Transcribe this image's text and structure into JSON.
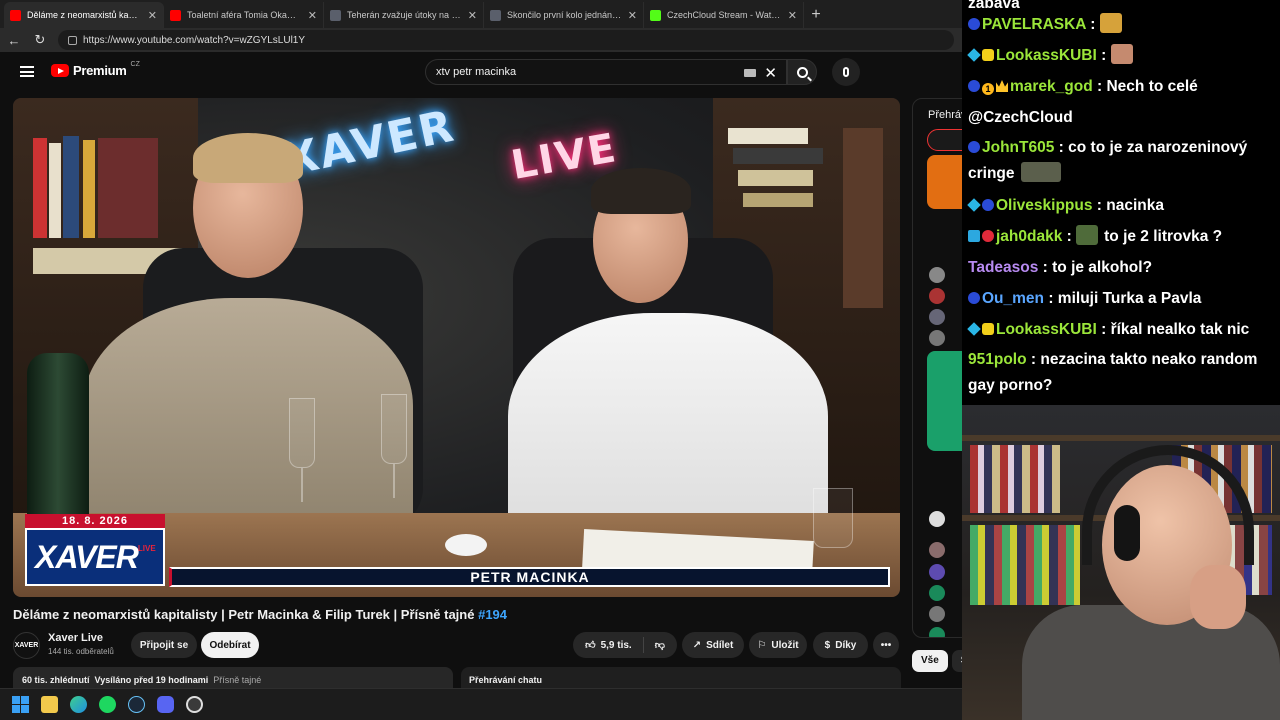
{
  "browser": {
    "tabs": [
      {
        "label": "Děláme z neomarxistů kapitalistu",
        "favicon_color": "#ff0000",
        "active": true
      },
      {
        "label": "Toaletní aféra Tomia Okamury. Co",
        "favicon_color": "#ff0000",
        "active": false
      },
      {
        "label": "Teherán zvažuje útoky na vojensk",
        "favicon_color": "#5a5f6b",
        "active": false
      },
      {
        "label": "Skončilo první kolo jednání minist",
        "favicon_color": "#5a5f6b",
        "active": false
      },
      {
        "label": "CzechCloud Stream - Watch Live o",
        "favicon_color": "#53fc18",
        "active": false
      }
    ],
    "url": "https://www.youtube.com/watch?v=wZGYLsLUl1Y"
  },
  "youtube": {
    "brand": "Premium",
    "country": "CZ",
    "search_value": "xtv petr macinka",
    "video": {
      "neon_left": "XAVER",
      "neon_right": "LIVE",
      "date": "18. 8. 2026",
      "logo_text": "XAVER",
      "logo_live": "LIVE",
      "lower_third_name": "PETR MACINKA"
    },
    "title": "Děláme z neomarxistů kapitalisty | Petr Macinka & Filip Turek | Přísně tajné",
    "title_tag": "#194",
    "channel": {
      "avatar_text": "XAVER",
      "name": "Xaver Live",
      "subscribers": "144 tis. odběratelů",
      "join_label": "Připojit se",
      "subscribe_label": "Odebírat"
    },
    "actions": {
      "likes": "5,9 tis.",
      "share": "Sdílet",
      "save": "Uložit",
      "thanks": "Díky",
      "more": "•••"
    },
    "description": {
      "views": "60 tis. zhlédnutí",
      "streamed": "Vysíláno před 19 hodinami",
      "playlist": "Přísně tajné"
    },
    "chat_replay_label": "Přehrávání chatu",
    "side_panel": {
      "title": "Přehrávání chatu",
      "chip_all": "Vše",
      "chip_partial": "S"
    }
  },
  "stream_chat": {
    "partial_top": "zabava",
    "messages": [
      {
        "user": "PAVELRASKA",
        "user_color": "#9be63a",
        "badges": [
          "blue"
        ],
        "text": "",
        "emote": "#d6a23a"
      },
      {
        "user": "LookassKUBI",
        "user_color": "#9be63a",
        "badges": [
          "cube",
          "yel"
        ],
        "text": "",
        "emote": "#c58a6f"
      },
      {
        "user": "marek_god",
        "user_color": "#9be63a",
        "badges": [
          "blue",
          "gold",
          "crown"
        ],
        "text": "Nech to celé @CzechCloud",
        "emote": ""
      },
      {
        "user": "JohnT605",
        "user_color": "#9be63a",
        "badges": [
          "blue"
        ],
        "text": "co to je za narozeninový cringe",
        "emote": "#5b5f4c"
      },
      {
        "user": "Oliveskippus",
        "user_color": "#9be63a",
        "badges": [
          "cube",
          "blue"
        ],
        "text": "nacinka",
        "emote": ""
      },
      {
        "user": "jah0dakk",
        "user_color": "#9be63a",
        "badges": [
          "prime",
          "red"
        ],
        "text": "to je 2 litrovka ?",
        "emote": "#4f6b3a"
      },
      {
        "user": "Tadeasos",
        "user_color": "#b78af0",
        "badges": [],
        "text": "to je alkohol?",
        "emote": ""
      },
      {
        "user": "Ou_men",
        "user_color": "#5aa6ff",
        "badges": [
          "blue"
        ],
        "text": "miluji Turka a Pavla",
        "emote": ""
      },
      {
        "user": "LookassKUBI",
        "user_color": "#9be63a",
        "badges": [
          "cube",
          "yel"
        ],
        "text": "říkal nealko tak nic",
        "emote": ""
      },
      {
        "user": "951polo",
        "user_color": "#9be63a",
        "badges": [],
        "text": "nezacina takto neako random gay porno?",
        "emote": ""
      }
    ]
  },
  "taskbar": {
    "icons": [
      "windows-start-icon",
      "file-explorer-icon",
      "edge-icon",
      "spotify-icon",
      "steam-icon",
      "discord-icon",
      "obs-icon"
    ]
  }
}
